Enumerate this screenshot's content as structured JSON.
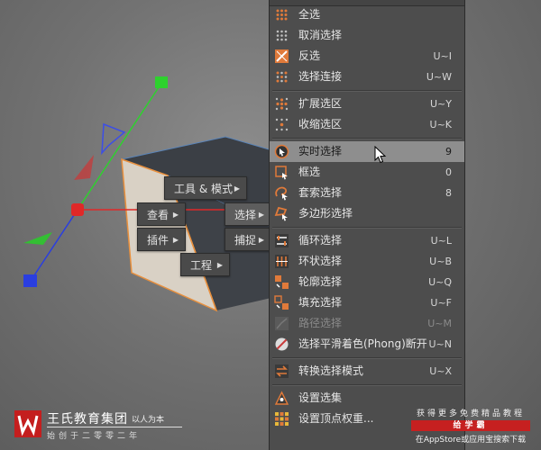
{
  "colors": {
    "menu_bg": "#4d4d4d",
    "highlight": "#8e8e8e",
    "icon_orange": "#e07a3a",
    "gizmo_x": "#e02828",
    "gizmo_y": "#2ed12e",
    "gizmo_z": "#2a3ee0",
    "brand_red": "#c41e1e"
  },
  "context_menu": {
    "items": [
      {
        "icon": "select-all-icon",
        "label": "全选",
        "key": ""
      },
      {
        "icon": "deselect-all-icon",
        "label": "取消选择",
        "key": ""
      },
      {
        "icon": "invert-selection-icon",
        "label": "反选",
        "key": "U~I"
      },
      {
        "icon": "select-connected-icon",
        "label": "选择连接",
        "key": "U~W"
      },
      {
        "icon": "grow-selection-icon",
        "label": "扩展选区",
        "key": "U~Y"
      },
      {
        "icon": "shrink-selection-icon",
        "label": "收缩选区",
        "key": "U~K"
      },
      {
        "icon": "live-selection-icon",
        "label": "实时选择",
        "key": "9"
      },
      {
        "icon": "rectangle-selection-icon",
        "label": "框选",
        "key": "0"
      },
      {
        "icon": "lasso-selection-icon",
        "label": "套索选择",
        "key": "8"
      },
      {
        "icon": "polygon-selection-icon",
        "label": "多边形选择",
        "key": ""
      },
      {
        "icon": "loop-selection-icon",
        "label": "循环选择",
        "key": "U~L"
      },
      {
        "icon": "ring-selection-icon",
        "label": "环状选择",
        "key": "U~B"
      },
      {
        "icon": "outline-selection-icon",
        "label": "轮廓选择",
        "key": "U~Q"
      },
      {
        "icon": "fill-selection-icon",
        "label": "填充选择",
        "key": "U~F"
      },
      {
        "icon": "path-selection-icon",
        "label": "路径选择",
        "key": "U~M"
      },
      {
        "icon": "phong-break-selection-icon",
        "label": "选择平滑着色(Phong)断开",
        "key": "U~N"
      },
      {
        "icon": "convert-selection-icon",
        "label": "转换选择模式",
        "key": "U~X"
      },
      {
        "icon": "set-selection-icon",
        "label": "设置选集",
        "key": ""
      },
      {
        "icon": "set-vertex-weight-icon",
        "label": "设置顶点权重...",
        "key": ""
      }
    ]
  },
  "hud_menu": {
    "tools_modes": "工具 & 模式",
    "view": "查看",
    "select": "选择",
    "plugins": "插件",
    "snap": "捕捉",
    "project": "工程"
  },
  "branding": {
    "name": "王氏教育集团",
    "motto": "以人为本",
    "sub": "始创于二零零二年"
  },
  "promo": {
    "line1": "获得更多免费精品教程",
    "line2": "给学霸",
    "line3": "在AppStore或应用宝搜索下载"
  }
}
